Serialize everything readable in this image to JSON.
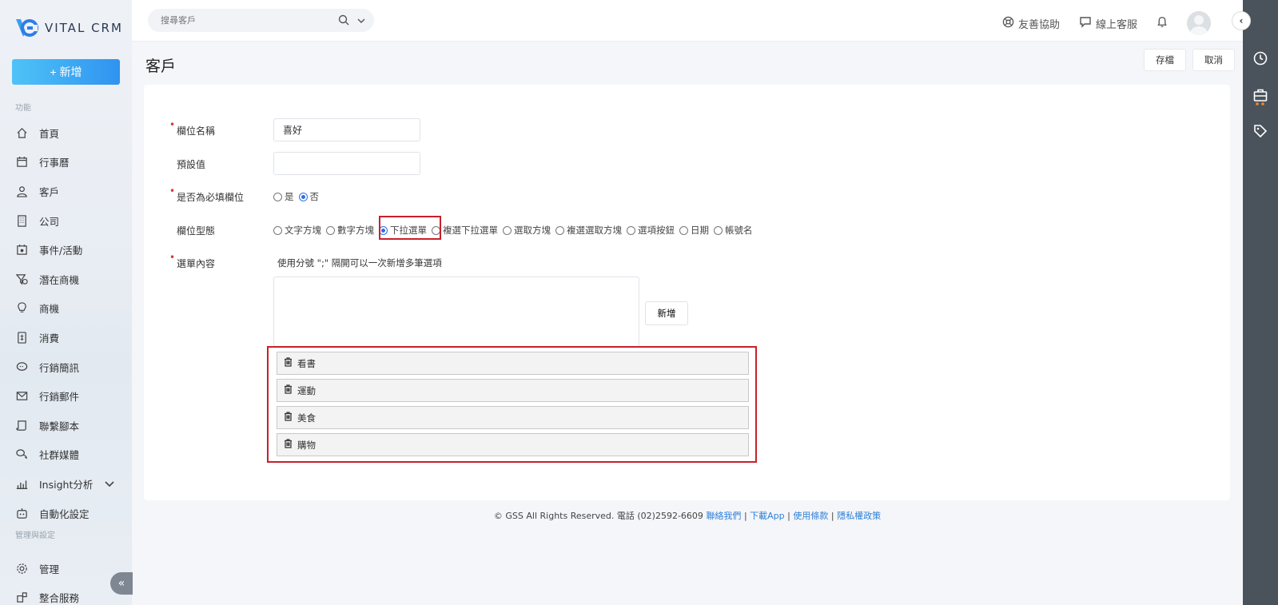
{
  "brand": {
    "name": "VITAL CRM",
    "accent": "#2f93f0"
  },
  "sidebar": {
    "new_button": "+ 新增",
    "section_functions": "功能",
    "section_admin": "管理與設定",
    "items": [
      {
        "label": "首頁",
        "icon": "home-icon"
      },
      {
        "label": "行事曆",
        "icon": "calendar-icon"
      },
      {
        "label": "客戶",
        "icon": "customer-icon"
      },
      {
        "label": "公司",
        "icon": "building-icon"
      },
      {
        "label": "事件/活動",
        "icon": "event-icon"
      },
      {
        "label": "潛在商機",
        "icon": "funnel-icon"
      },
      {
        "label": "商機",
        "icon": "lightbulb-icon"
      },
      {
        "label": "消費",
        "icon": "receipt-icon"
      },
      {
        "label": "行銷簡訊",
        "icon": "sms-icon"
      },
      {
        "label": "行銷郵件",
        "icon": "mail-icon"
      },
      {
        "label": "聯繫腳本",
        "icon": "script-icon"
      },
      {
        "label": "社群媒體",
        "icon": "social-icon"
      },
      {
        "label": "Insight分析",
        "icon": "chart-icon"
      },
      {
        "label": "自動化設定",
        "icon": "robot-icon"
      }
    ],
    "admin_items": [
      {
        "label": "管理",
        "icon": "gear-icon"
      },
      {
        "label": "整合服務",
        "icon": "plugin-icon"
      }
    ]
  },
  "topbar": {
    "search_placeholder": "搜尋客戶",
    "help_label": "友善協助",
    "support_label": "線上客服"
  },
  "page": {
    "title": "客戶",
    "save_label": "存檔",
    "cancel_label": "取消"
  },
  "form": {
    "field_name_label": "欄位名稱",
    "field_name_value": "喜好",
    "default_label": "預設值",
    "default_value": "",
    "required_label": "是否為必填欄位",
    "required_yes": "是",
    "required_no": "否",
    "type_label": "欄位型態",
    "types": [
      "文字方塊",
      "數字方塊",
      "下拉選單",
      "複選下拉選單",
      "選取方塊",
      "複選選取方塊",
      "選項按鈕",
      "日期",
      "帳號名"
    ],
    "selected_type": "下拉選單",
    "options_label": "選單內容",
    "options_hint": "使用分號 \";\" 隔開可以一次新增多筆選項",
    "add_label": "新增",
    "options": [
      "看書",
      "運動",
      "美食",
      "購物"
    ]
  },
  "footer": {
    "copyright": "© GSS All Rights Reserved. 電話 (02)2592-6609",
    "links": [
      "聯絡我們",
      "下載App",
      "使用條款",
      "隱私權政策"
    ],
    "sep": "|"
  }
}
